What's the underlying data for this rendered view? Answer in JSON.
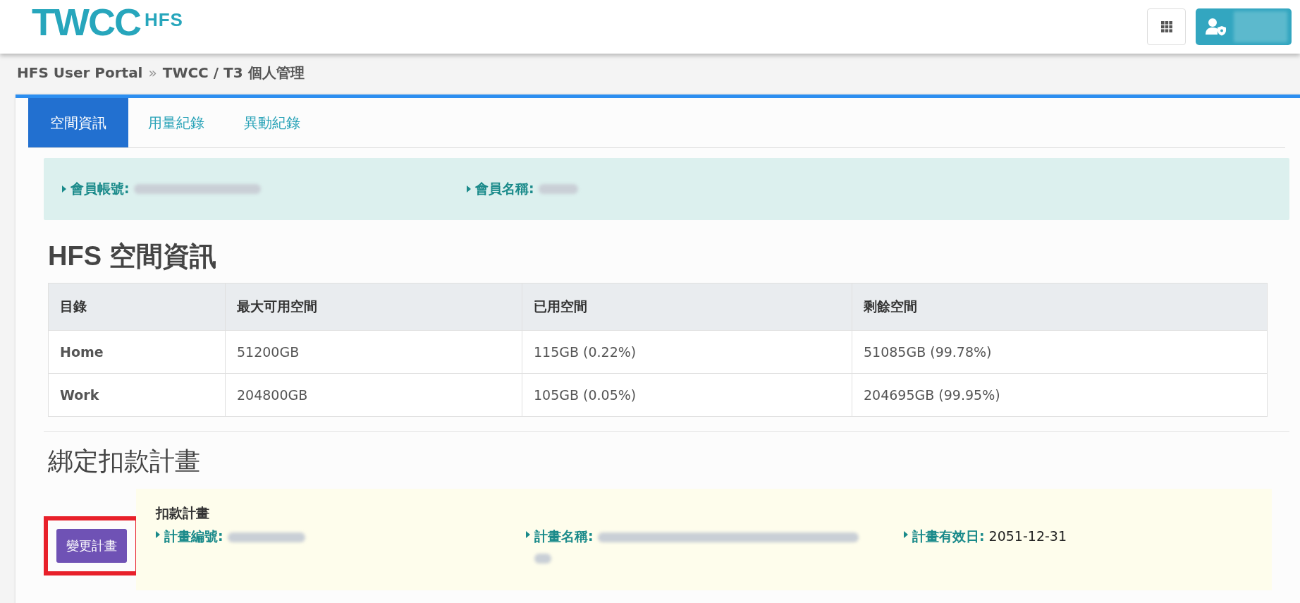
{
  "header": {
    "logo": {
      "main": "TWCC",
      "sub": "HFS"
    }
  },
  "breadcrumb": {
    "items": [
      "HFS User Portal",
      "TWCC / T3 個人管理"
    ],
    "separator": "»"
  },
  "tabs": [
    {
      "label": "空間資訊",
      "selected": true
    },
    {
      "label": "用量紀錄",
      "selected": false
    },
    {
      "label": "異動紀錄",
      "selected": false
    }
  ],
  "member_info": [
    {
      "label": "會員帳號:"
    },
    {
      "label": "會員名稱:"
    }
  ],
  "space_section": {
    "title": "HFS 空間資訊",
    "columns": [
      "目錄",
      "最大可用空間",
      "已用空間",
      "剩餘空間"
    ],
    "rows": [
      [
        "Home",
        "51200GB",
        "115GB (0.22%)",
        "51085GB (99.78%)"
      ],
      [
        "Work",
        "204800GB",
        "105GB (0.05%)",
        "204695GB (99.95%)"
      ]
    ]
  },
  "plan_section": {
    "title": "綁定扣款計畫",
    "button": "變更計畫",
    "highlighted": true,
    "box_title": "扣款計畫",
    "fields": [
      {
        "label": "計畫編號:"
      },
      {
        "label": "計畫名稱:"
      },
      {
        "label": "計畫有效日:",
        "value": "2051-12-31"
      }
    ]
  }
}
